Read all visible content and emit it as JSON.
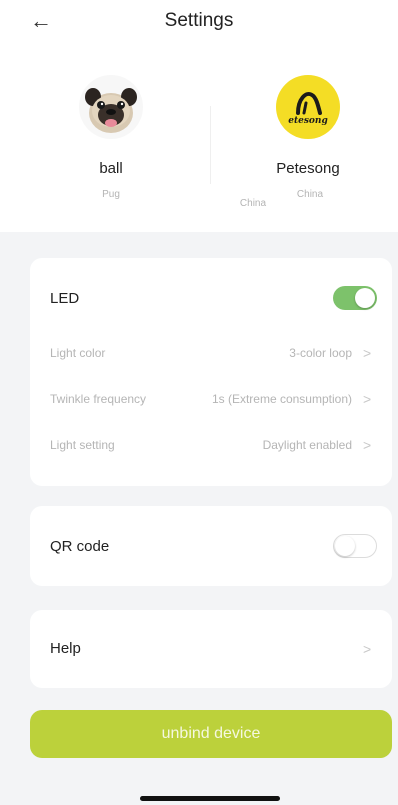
{
  "header": {
    "back_glyph": "←",
    "title": "Settings"
  },
  "profiles": [
    {
      "name": "ball",
      "breed": "Pug",
      "location": "China",
      "avatar_icon": "pug-icon"
    },
    {
      "name": "Petesong",
      "location": "China",
      "avatar_icon": "petesong-logo-icon",
      "logo_text": "etesong"
    }
  ],
  "led": {
    "label": "LED",
    "enabled": true,
    "settings": [
      {
        "label": "Light color",
        "value": "3-color loop"
      },
      {
        "label": "Twinkle frequency",
        "value": "1s (Extreme consumption)"
      },
      {
        "label": "Light setting",
        "value": "Daylight enabled"
      }
    ]
  },
  "qr": {
    "label": "QR code",
    "enabled": false
  },
  "help": {
    "label": "Help"
  },
  "unbind": {
    "label": "unbind device"
  },
  "colors": {
    "accent_green": "#7dc26b",
    "unbind_button": "#bcd13b",
    "logo_yellow": "#f4dd25"
  }
}
